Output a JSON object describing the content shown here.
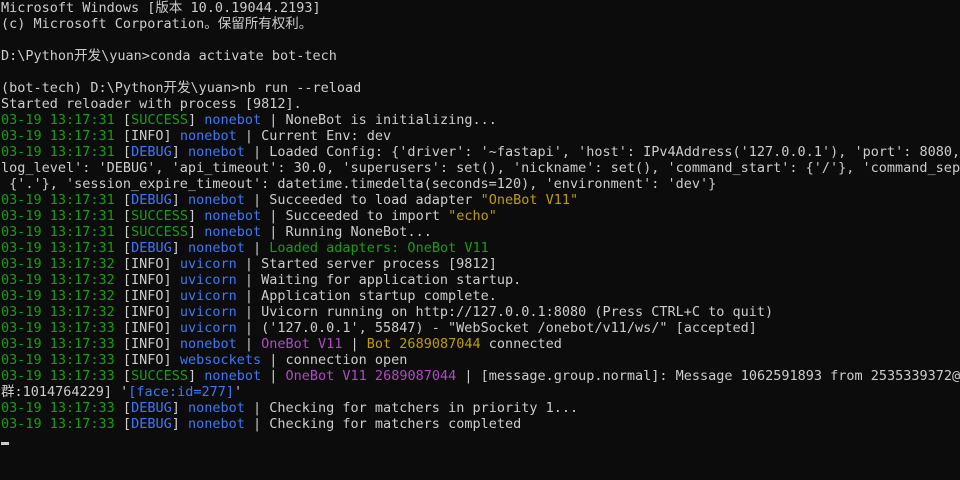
{
  "terminal": {
    "colors": {
      "default": "#cccccc",
      "green": "#13a10e",
      "blue": "#3b78ff",
      "yellow": "#c19c00",
      "magenta": "#b148c6"
    },
    "lines": [
      {
        "segments": [
          {
            "text": "Microsoft Windows [版本 10.0.19044.2193]",
            "color": "default"
          }
        ]
      },
      {
        "segments": [
          {
            "text": "(c) Microsoft Corporation。保留所有权利。",
            "color": "default"
          }
        ]
      },
      {
        "segments": []
      },
      {
        "segments": [
          {
            "text": "D:\\Python开发\\yuan>conda activate bot-tech",
            "color": "default"
          }
        ]
      },
      {
        "segments": []
      },
      {
        "segments": [
          {
            "text": "(bot-tech) D:\\Python开发\\yuan>nb run --reload",
            "color": "default"
          }
        ]
      },
      {
        "segments": [
          {
            "text": "Started reloader with process [9812].",
            "color": "default"
          }
        ]
      },
      {
        "segments": [
          {
            "text": "03-19 13:17:31 ",
            "color": "green"
          },
          {
            "text": "[",
            "color": "default"
          },
          {
            "text": "SUCCESS",
            "color": "green"
          },
          {
            "text": "] ",
            "color": "default"
          },
          {
            "text": "nonebot",
            "color": "blue"
          },
          {
            "text": " | NoneBot is initializing...",
            "color": "default"
          }
        ]
      },
      {
        "segments": [
          {
            "text": "03-19 13:17:31 ",
            "color": "green"
          },
          {
            "text": "[INFO] ",
            "color": "default"
          },
          {
            "text": "nonebot",
            "color": "blue"
          },
          {
            "text": " | Current Env: dev",
            "color": "default"
          }
        ]
      },
      {
        "segments": [
          {
            "text": "03-19 13:17:31 ",
            "color": "green"
          },
          {
            "text": "[",
            "color": "default"
          },
          {
            "text": "DEBUG",
            "color": "blue"
          },
          {
            "text": "] ",
            "color": "default"
          },
          {
            "text": "nonebot",
            "color": "blue"
          },
          {
            "text": " | Loaded Config: {'driver': '~fastapi', 'host': IPv4Address('127.0.0.1'), 'port': 8080, '",
            "color": "default"
          }
        ]
      },
      {
        "segments": [
          {
            "text": "log_level': 'DEBUG', 'api_timeout': 30.0, 'superusers': set(), 'nickname': set(), 'command_start': {'/'}, 'command_sep':",
            "color": "default"
          }
        ]
      },
      {
        "segments": [
          {
            "text": " {'.'}, 'session_expire_timeout': datetime.timedelta(seconds=120), 'environment': 'dev'}",
            "color": "default"
          }
        ]
      },
      {
        "segments": [
          {
            "text": "03-19 13:17:31 ",
            "color": "green"
          },
          {
            "text": "[",
            "color": "default"
          },
          {
            "text": "DEBUG",
            "color": "blue"
          },
          {
            "text": "] ",
            "color": "default"
          },
          {
            "text": "nonebot",
            "color": "blue"
          },
          {
            "text": " | Succeeded to load adapter ",
            "color": "default"
          },
          {
            "text": "\"OneBot V11\"",
            "color": "yellow"
          }
        ]
      },
      {
        "segments": [
          {
            "text": "03-19 13:17:31 ",
            "color": "green"
          },
          {
            "text": "[",
            "color": "default"
          },
          {
            "text": "SUCCESS",
            "color": "green"
          },
          {
            "text": "] ",
            "color": "default"
          },
          {
            "text": "nonebot",
            "color": "blue"
          },
          {
            "text": " | Succeeded to import ",
            "color": "default"
          },
          {
            "text": "\"echo\"",
            "color": "yellow"
          }
        ]
      },
      {
        "segments": [
          {
            "text": "03-19 13:17:31 ",
            "color": "green"
          },
          {
            "text": "[",
            "color": "default"
          },
          {
            "text": "SUCCESS",
            "color": "green"
          },
          {
            "text": "] ",
            "color": "default"
          },
          {
            "text": "nonebot",
            "color": "blue"
          },
          {
            "text": " | Running NoneBot...",
            "color": "default"
          }
        ]
      },
      {
        "segments": [
          {
            "text": "03-19 13:17:31 ",
            "color": "green"
          },
          {
            "text": "[",
            "color": "default"
          },
          {
            "text": "DEBUG",
            "color": "blue"
          },
          {
            "text": "] ",
            "color": "default"
          },
          {
            "text": "nonebot",
            "color": "blue"
          },
          {
            "text": " | ",
            "color": "default"
          },
          {
            "text": "Loaded adapters: OneBot V11",
            "color": "green"
          }
        ]
      },
      {
        "segments": [
          {
            "text": "03-19 13:17:32 ",
            "color": "green"
          },
          {
            "text": "[INFO] ",
            "color": "default"
          },
          {
            "text": "uvicorn",
            "color": "blue"
          },
          {
            "text": " | Started server process [9812]",
            "color": "default"
          }
        ]
      },
      {
        "segments": [
          {
            "text": "03-19 13:17:32 ",
            "color": "green"
          },
          {
            "text": "[INFO] ",
            "color": "default"
          },
          {
            "text": "uvicorn",
            "color": "blue"
          },
          {
            "text": " | Waiting for application startup.",
            "color": "default"
          }
        ]
      },
      {
        "segments": [
          {
            "text": "03-19 13:17:32 ",
            "color": "green"
          },
          {
            "text": "[INFO] ",
            "color": "default"
          },
          {
            "text": "uvicorn",
            "color": "blue"
          },
          {
            "text": " | Application startup complete.",
            "color": "default"
          }
        ]
      },
      {
        "segments": [
          {
            "text": "03-19 13:17:32 ",
            "color": "green"
          },
          {
            "text": "[INFO] ",
            "color": "default"
          },
          {
            "text": "uvicorn",
            "color": "blue"
          },
          {
            "text": " | Uvicorn running on http://127.0.0.1:8080 (Press CTRL+C to quit)",
            "color": "default"
          }
        ]
      },
      {
        "segments": [
          {
            "text": "03-19 13:17:33 ",
            "color": "green"
          },
          {
            "text": "[INFO] ",
            "color": "default"
          },
          {
            "text": "uvicorn",
            "color": "blue"
          },
          {
            "text": " | ('127.0.0.1', 55847) - \"WebSocket /onebot/v11/ws/\" [accepted]",
            "color": "default"
          }
        ]
      },
      {
        "segments": [
          {
            "text": "03-19 13:17:33 ",
            "color": "green"
          },
          {
            "text": "[INFO] ",
            "color": "default"
          },
          {
            "text": "nonebot",
            "color": "blue"
          },
          {
            "text": " | ",
            "color": "default"
          },
          {
            "text": "OneBot V11",
            "color": "magenta"
          },
          {
            "text": " | ",
            "color": "default"
          },
          {
            "text": "Bot 2689087044",
            "color": "yellow"
          },
          {
            "text": " connected",
            "color": "default"
          }
        ]
      },
      {
        "segments": [
          {
            "text": "03-19 13:17:33 ",
            "color": "green"
          },
          {
            "text": "[INFO] ",
            "color": "default"
          },
          {
            "text": "websockets",
            "color": "blue"
          },
          {
            "text": " | connection open",
            "color": "default"
          }
        ]
      },
      {
        "segments": [
          {
            "text": "03-19 13:17:33 ",
            "color": "green"
          },
          {
            "text": "[",
            "color": "default"
          },
          {
            "text": "SUCCESS",
            "color": "green"
          },
          {
            "text": "] ",
            "color": "default"
          },
          {
            "text": "nonebot",
            "color": "blue"
          },
          {
            "text": " | ",
            "color": "default"
          },
          {
            "text": "OneBot V11 2689087044",
            "color": "magenta"
          },
          {
            "text": " | [message.group.normal]: Message 1062591893 from 2535339372@[",
            "color": "default"
          }
        ]
      },
      {
        "segments": [
          {
            "text": "群:1014764229] '",
            "color": "default"
          },
          {
            "text": "[face:id=277]",
            "color": "blue"
          },
          {
            "text": "'",
            "color": "default"
          }
        ]
      },
      {
        "segments": [
          {
            "text": "03-19 13:17:33 ",
            "color": "green"
          },
          {
            "text": "[",
            "color": "default"
          },
          {
            "text": "DEBUG",
            "color": "blue"
          },
          {
            "text": "] ",
            "color": "default"
          },
          {
            "text": "nonebot",
            "color": "blue"
          },
          {
            "text": " | Checking for matchers in priority 1...",
            "color": "default"
          }
        ]
      },
      {
        "segments": [
          {
            "text": "03-19 13:17:33 ",
            "color": "green"
          },
          {
            "text": "[",
            "color": "default"
          },
          {
            "text": "DEBUG",
            "color": "blue"
          },
          {
            "text": "] ",
            "color": "default"
          },
          {
            "text": "nonebot",
            "color": "blue"
          },
          {
            "text": " | Checking for matchers completed",
            "color": "default"
          }
        ]
      },
      {
        "segments": []
      }
    ]
  }
}
